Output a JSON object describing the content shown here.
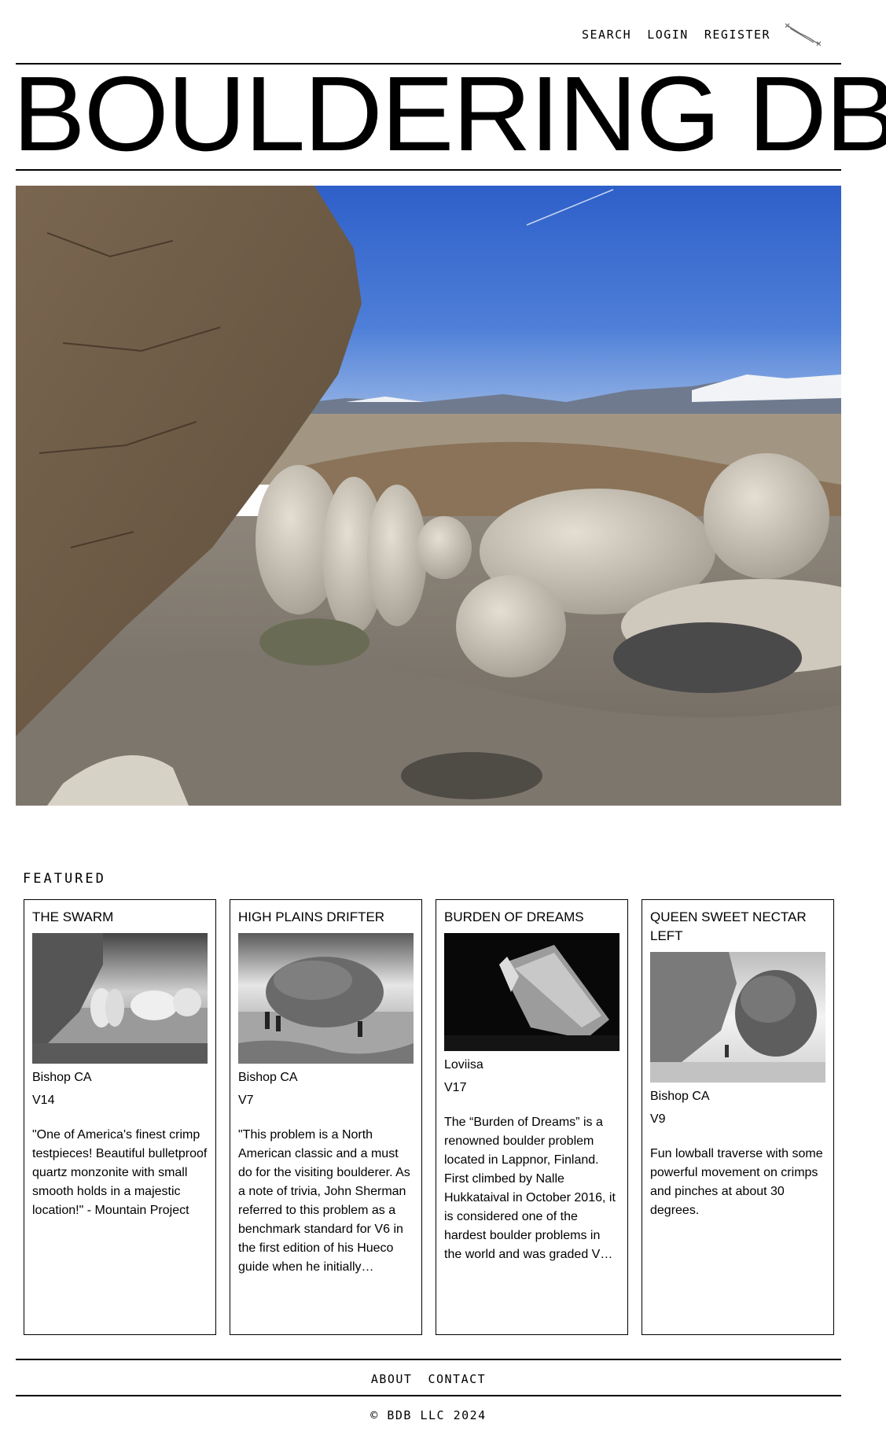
{
  "nav": {
    "search": "SEARCH",
    "login": "LOGIN",
    "register": "REGISTER"
  },
  "site_title": "BOULDERING DB",
  "featured": {
    "heading": "FEATURED",
    "cards": [
      {
        "title": "THE SWARM",
        "location": "Bishop CA",
        "grade": "V14",
        "description": "\"One of America's finest crimp testpieces! Beautiful bulletproof quartz monzonite with small smooth holds in a majestic location!\" - Mountain Project"
      },
      {
        "title": "HIGH PLAINS DRIFTER",
        "location": "Bishop CA",
        "grade": "V7",
        "description": "\"This problem is a North American classic and a must do for the visiting boulderer. As a note of trivia, John Sherman referred to this problem as a benchmark standard for V6 in the first edition of his Hueco guide when he initially…"
      },
      {
        "title": "BURDEN OF DREAMS",
        "location": "Loviisa",
        "grade": "V17",
        "description": "The “Burden of Dreams” is a renowned boulder problem located in Lappnor, Finland. First climbed by Nalle Hukkataival in October 2016, it is considered one of the hardest boulder problems in the world and was graded V…"
      },
      {
        "title": "QUEEN SWEET NECTAR LEFT",
        "location": "Bishop CA",
        "grade": "V9",
        "description": "Fun lowball traverse with some powerful movement on crimps and pinches at about 30 degrees."
      }
    ]
  },
  "footer": {
    "about": "ABOUT",
    "contact": "CONTACT",
    "copyright": "© BDB LLC 2024"
  },
  "icons": {
    "brand": "constellation-icon"
  },
  "colors": {
    "text": "#000000",
    "background": "#ffffff",
    "sky": "#3f6fd0"
  }
}
